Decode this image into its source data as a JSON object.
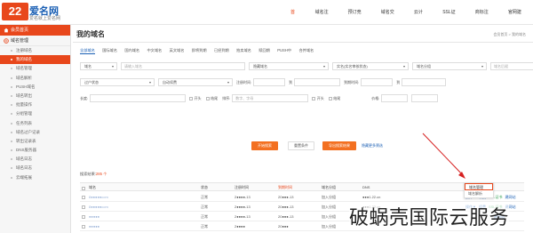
{
  "header": {
    "logo_badge": "22",
    "logo_name": "爱名网",
    "logo_sub": "爱名就上爱名网",
    "nav": [
      "首页",
      "域名注册",
      "预订竞价",
      "域名交易",
      "云计算",
      "SSL证书",
      "商标注册",
      "官网建站"
    ],
    "active_nav": 0,
    "accent": "#e8471b"
  },
  "sidebar": {
    "home": "会员首页",
    "group": "域名管理",
    "items": [
      "注册域名",
      "我的域名",
      "域名管理",
      "域名解析",
      "PUSH域名",
      "域名转出",
      "批量操作",
      "分组管理",
      "任务列表",
      "域名过户记录",
      "转出记录表",
      "DNS服务器",
      "域名日志",
      "域名日志",
      "云端拓展"
    ],
    "active_item": 1
  },
  "page": {
    "title": "我的域名",
    "breadcrumb": "会员首页 > 我的域名"
  },
  "tabs": {
    "items": [
      "全部域名",
      "国际域名",
      "国内域名",
      "中文域名",
      "英文域名",
      "即将到期",
      "已经到期",
      "拍卖域名",
      "赎回期",
      "PUSH中",
      "合并域名"
    ],
    "active": 0
  },
  "filters": {
    "row1": {
      "select_a": "域名",
      "input_a_placeholder": "请输入域名",
      "select_b": "隐藏域名",
      "select_c": "实名(实名审核状态)",
      "select_d": "域名分组",
      "input_b_placeholder": "域名后缀"
    },
    "row2": {
      "select_a": "过户状态",
      "select_b": "自动续费",
      "label_reg": "注册时间:",
      "to_a": "到",
      "label_exp": "到期时间:",
      "to_b": "到"
    },
    "row3": {
      "label_len": "长度:",
      "chk_a": "开头",
      "chk_b": "结尾",
      "label_sort": "排序:",
      "sort_placeholder": "数字、字母",
      "chk_c": "开头",
      "chk_d": "结尾",
      "label_price": "价格:"
    }
  },
  "buttons": {
    "search": "开始搜索",
    "reset": "重置条件",
    "export": "导出搜索结果",
    "more": "隐藏更多筛选"
  },
  "results": {
    "label": "搜索结果:",
    "count": "285 个",
    "columns": [
      "域名",
      "状态",
      "注册时间",
      "到期时间",
      "域名分组",
      "DNS",
      "操作"
    ],
    "sorted_column": 3,
    "rows": [
      {
        "domain": "8●●●●●com",
        "status": "正常",
        "reg": "2●●●●-13",
        "exp": "20●●●-13",
        "group": "加入分组",
        "dns": "●●●1.22.cn",
        "ops": [
          "操作▼",
          "续费",
          "SSL证书",
          "建网站"
        ]
      },
      {
        "domain": "8●●●●●com",
        "status": "正常",
        "reg": "2●●●●-13",
        "exp": "20●●●-13",
        "group": "加入分组",
        "dns": "●●●1.22.cn",
        "ops": [
          "操作▼",
          "续费",
          "SSL证书",
          "建网站"
        ]
      },
      {
        "domain": "●●●●●",
        "status": "正常",
        "reg": "2●●●●-13",
        "exp": "20●●●-13",
        "group": "加入分组",
        "dns": "",
        "ops": [
          "",
          "续费",
          "",
          "建网站"
        ]
      },
      {
        "domain": "●●●●●",
        "status": "正常",
        "reg": "2●●●●",
        "exp": "20●●●",
        "group": "加入分组",
        "dns": "",
        "ops": []
      }
    ]
  },
  "dropdown": {
    "items": [
      "域名管理",
      "域名解析"
    ]
  },
  "watermark": "破蜗壳国际云服务"
}
